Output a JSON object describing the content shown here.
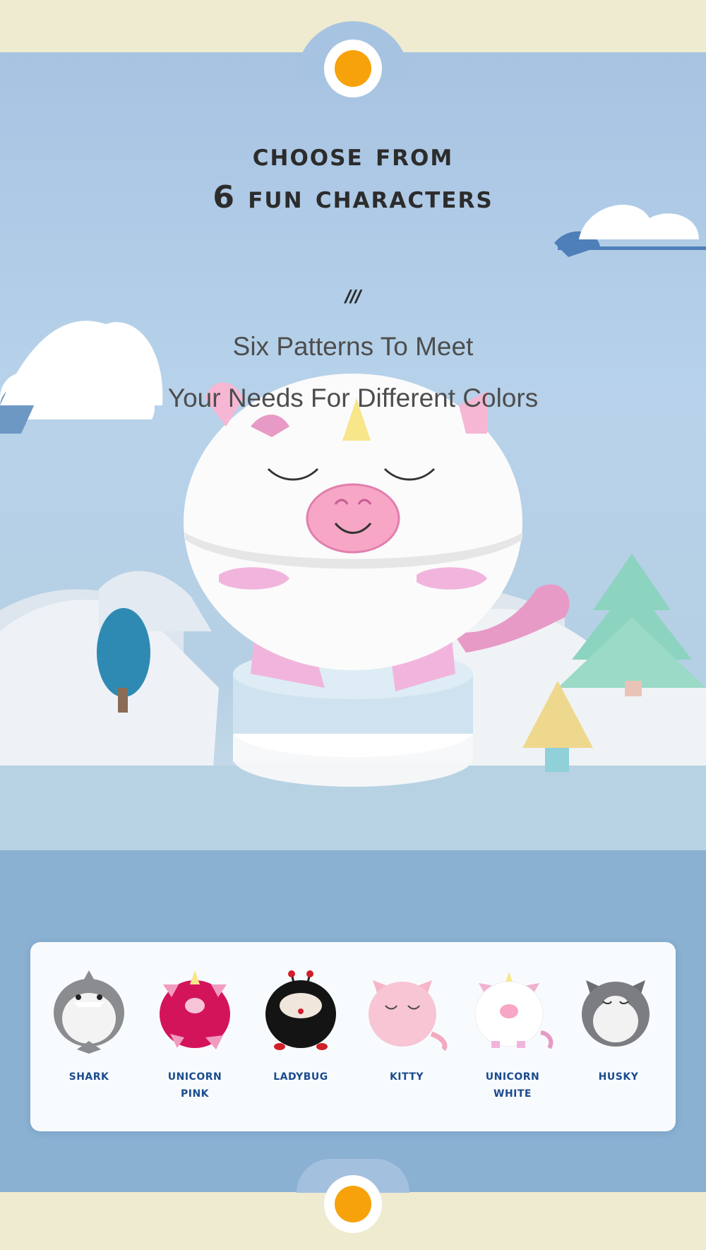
{
  "header": {
    "title_line1": "choose from",
    "title_line2": "6 fun characters",
    "divider": "///",
    "subtitle_line1": "Six Patterns To Meet",
    "subtitle_line2": "Your Needs For Different Colors"
  },
  "accent_colors": {
    "cream": "#efebd0",
    "sky_blue": "#a7c3e2",
    "orange_dot": "#f7a20a",
    "label_blue": "#1b4b8f"
  },
  "characters": [
    {
      "label_line1": "shark",
      "label_line2": "",
      "icon": "shark-plush-icon"
    },
    {
      "label_line1": "unicorn",
      "label_line2": "pink",
      "icon": "pink-unicorn-plush-icon"
    },
    {
      "label_line1": "ladybug",
      "label_line2": "",
      "icon": "ladybug-plush-icon"
    },
    {
      "label_line1": "kitty",
      "label_line2": "",
      "icon": "kitty-plush-icon"
    },
    {
      "label_line1": "unicorn",
      "label_line2": "white",
      "icon": "white-unicorn-plush-icon"
    },
    {
      "label_line1": "husky",
      "label_line2": "",
      "icon": "husky-plush-icon"
    }
  ]
}
